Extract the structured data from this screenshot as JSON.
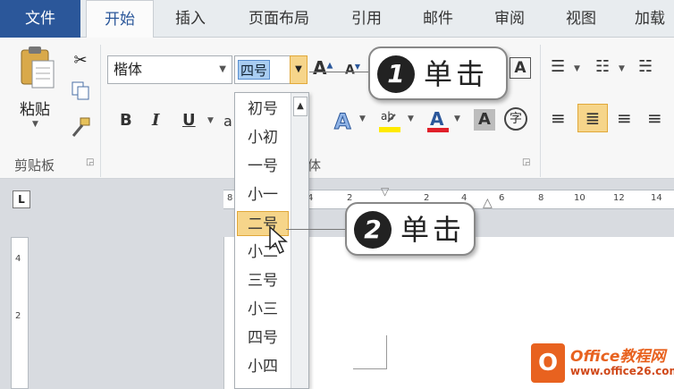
{
  "tabs": [
    {
      "label": "文件"
    },
    {
      "label": "开始"
    },
    {
      "label": "插入"
    },
    {
      "label": "页面布局"
    },
    {
      "label": "引用"
    },
    {
      "label": "邮件"
    },
    {
      "label": "审阅"
    },
    {
      "label": "视图"
    },
    {
      "label": "加载"
    }
  ],
  "clipboard": {
    "paste_label": "粘贴",
    "group_label": "剪贴板"
  },
  "font": {
    "name": "楷体",
    "size": "四号",
    "group_label": "体",
    "bold": "B",
    "italic": "I",
    "underline": "U"
  },
  "size_list": [
    "初号",
    "小初",
    "一号",
    "小一",
    "二号",
    "小二",
    "三号",
    "小三",
    "四号",
    "小四"
  ],
  "size_highlighted": "二号",
  "ruler": {
    "ticks": [
      "8",
      "6",
      "4",
      "2",
      "2",
      "4",
      "6",
      "8",
      "10",
      "12",
      "14"
    ],
    "v_ticks": [
      "4",
      "2"
    ]
  },
  "tab_selector": "L",
  "callouts": [
    {
      "num": "1",
      "text": "单击"
    },
    {
      "num": "2",
      "text": "单击"
    }
  ],
  "watermark": {
    "logo": "O",
    "line1": "Office教程网",
    "line2": "www.office26.com"
  },
  "colors": {
    "file_tab": "#2b579a",
    "highlight": "#f6d58a",
    "accent": "#e8621f"
  }
}
